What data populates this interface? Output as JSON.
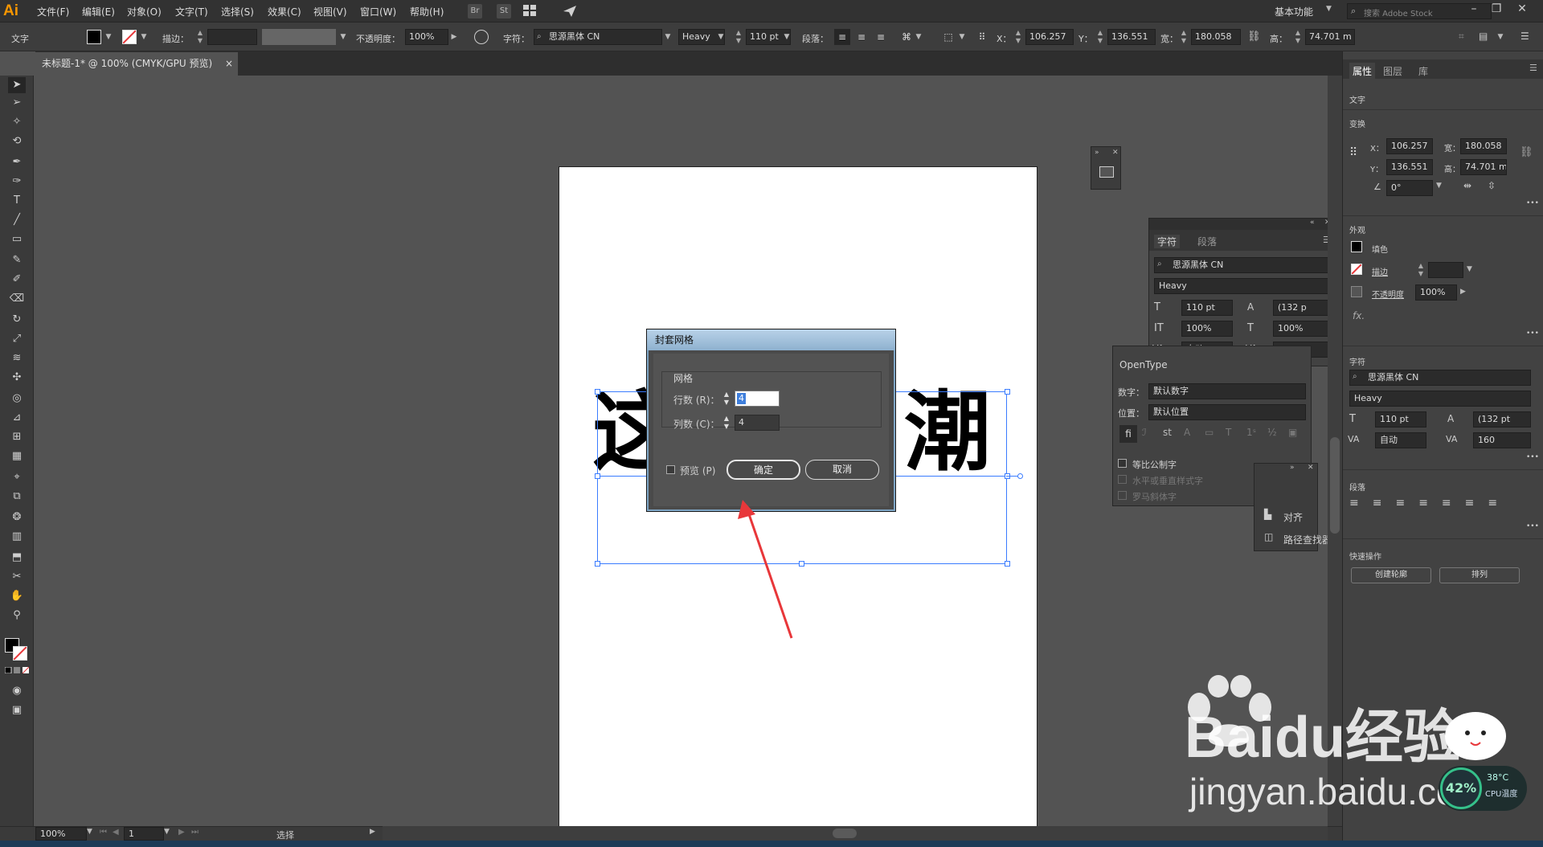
{
  "app": {
    "logo": "Ai"
  },
  "menu": [
    "文件(F)",
    "编辑(E)",
    "对象(O)",
    "文字(T)",
    "选择(S)",
    "效果(C)",
    "视图(V)",
    "窗口(W)",
    "帮助(H)"
  ],
  "menubar_icons": [
    "Br",
    "St"
  ],
  "workspace": {
    "label": "基本功能",
    "search_placeholder": "搜索 Adobe Stock"
  },
  "control": {
    "type_label": "文字",
    "stroke_label": "描边：",
    "opacity_label": "不透明度：",
    "opacity_value": "100%",
    "char_label": "字符：",
    "font_name": "思源黑体 CN",
    "font_style": "Heavy",
    "font_size": "110 pt",
    "para_label": "段落：",
    "x_label": "X：",
    "x_value": "106.257",
    "y_label": "Y：",
    "y_value": "136.551",
    "w_label": "宽：",
    "w_value": "180.058",
    "h_label": "高：",
    "h_value": "74.701 m"
  },
  "document": {
    "tab_title": "未标题-1* @ 100% (CMYK/GPU 预览)",
    "close": "×"
  },
  "canvas_text": {
    "left_char": "这",
    "right_char": "潮"
  },
  "dialog": {
    "title": "封套网格",
    "group_label": "网格",
    "rows_label": "行数 (R)：",
    "rows_value": "4",
    "cols_label": "列数 (C)：",
    "cols_value": "4",
    "preview_label": "预览 (P)",
    "ok": "确定",
    "cancel": "取消"
  },
  "char_panel": {
    "tabs": [
      "字符",
      "段落"
    ],
    "font_name": "思源黑体 CN",
    "font_style": "Heavy",
    "size": "110 pt",
    "leading": "(132 p",
    "vscale": "100%",
    "hscale": "100%",
    "kerning": "自动",
    "tracking": "160"
  },
  "opentype_panel": {
    "title": "OpenType",
    "numbers_label": "数字：",
    "numbers_value": "默认数字",
    "position_label": "位置：",
    "position_value": "默认位置",
    "check1": "等比公制字",
    "check2": "水平或垂直样式字",
    "check3": "罗马斜体字"
  },
  "mini_panel": {
    "items": [
      "对齐",
      "路径查找器"
    ]
  },
  "properties": {
    "tabs": [
      "属性",
      "图层",
      "库"
    ],
    "object_type": "文字",
    "transform_label": "变换",
    "x_label": "X：",
    "x_value": "106.257",
    "w_label": "宽：",
    "w_value": "180.058",
    "y_label": "Y：",
    "y_value": "136.551",
    "h_label": "高：",
    "h_value": "74.701 m",
    "angle": "0°",
    "appearance_label": "外观",
    "fill_label": "填色",
    "stroke_label": "描边",
    "opacity_label": "不透明度",
    "opacity_value": "100%",
    "fx": "fx.",
    "char_label": "字符",
    "font_name": "思源黑体 CN",
    "font_style": "Heavy",
    "size": "110 pt",
    "leading": "(132 pt",
    "kerning": "自动",
    "tracking": "160",
    "para_label": "段落",
    "quick_label": "快速操作",
    "btn_outline": "创建轮廓",
    "btn_arrange": "排列",
    "more": "•••"
  },
  "status": {
    "zoom": "100%",
    "page": "1",
    "mode": "选择"
  },
  "watermark": {
    "brand": "Baidu经验",
    "url": "jingyan.baidu.com",
    "cpu_percent": "42%",
    "cpu_temp": "38°C",
    "cpu_label": "CPU温度"
  },
  "colors": {
    "accent_arrow": "#e8373a",
    "ai_orange": "#f79600",
    "selection": "#3a7cff"
  }
}
